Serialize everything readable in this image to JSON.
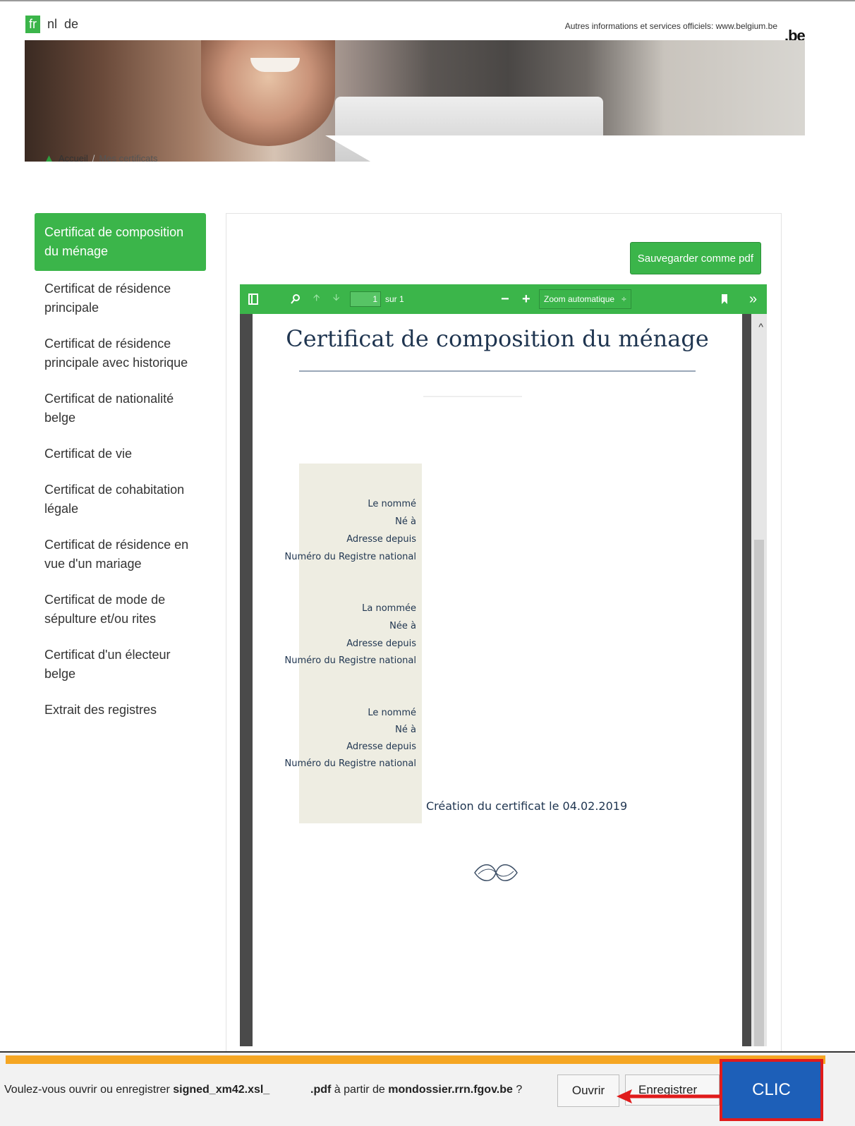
{
  "languages": {
    "items": [
      "fr",
      "nl",
      "de"
    ],
    "active": "fr"
  },
  "header": {
    "official_text": "Autres informations et services officiels: www.belgium.be",
    "logo": ".be"
  },
  "breadcrumb": {
    "home": "Accueil",
    "separator": "/",
    "current": "Mes certificats"
  },
  "sidebar": {
    "items": [
      {
        "label": "Certificat de composition du ménage",
        "active": true
      },
      {
        "label": "Certificat de résidence principale"
      },
      {
        "label": "Certificat de résidence principale avec historique"
      },
      {
        "label": "Certificat de nationalité belge"
      },
      {
        "label": "Certificat de vie"
      },
      {
        "label": "Certificat de cohabitation légale"
      },
      {
        "label": "Certificat de résidence en vue d'un mariage"
      },
      {
        "label": "Certificat de mode de sépulture et/ou rites"
      },
      {
        "label": "Certificat d'un électeur belge"
      },
      {
        "label": "Extrait des registres"
      }
    ]
  },
  "panel": {
    "save_button": "Sauvegarder comme pdf"
  },
  "viewer": {
    "page_number": "1",
    "page_total": "sur 1",
    "zoom": "Zoom automatique",
    "zoom_arrow": "÷",
    "minus": "−",
    "plus": "+",
    "more": "»",
    "scroll_up": "^"
  },
  "document": {
    "title": "Certificat de composition du ménage",
    "persons": [
      {
        "name_label": "Le nommé",
        "birth_label": "Né à",
        "address_label": "Adresse depuis",
        "rn_label": "Numéro du Registre national"
      },
      {
        "name_label": "La nommée",
        "birth_label": "Née à",
        "address_label": "Adresse depuis",
        "rn_label": "Numéro du Registre national"
      },
      {
        "name_label": "Le nommé",
        "birth_label": "Né à",
        "address_label": "Adresse depuis",
        "rn_label": "Numéro du Registre national"
      }
    ],
    "creation": "Création du certificat le 04.02.2019"
  },
  "download_bar": {
    "prompt_start": "Voulez-vous ouvrir ou enregistrer ",
    "filename_start": "signed_xm42.xsl_",
    "filename_end": ".pdf",
    "prompt_middle": " à partir de ",
    "domain": "mondossier.rrn.fgov.be",
    "prompt_end": " ?",
    "open_button": "Ouvrir",
    "save_button": "Enregistrer",
    "annotation": "CLIC"
  },
  "colors": {
    "brand_green": "#3bb54a",
    "annotation_red": "#e01b1b",
    "annotation_blue": "#1d5fb8",
    "bar_orange": "#f5a623"
  }
}
